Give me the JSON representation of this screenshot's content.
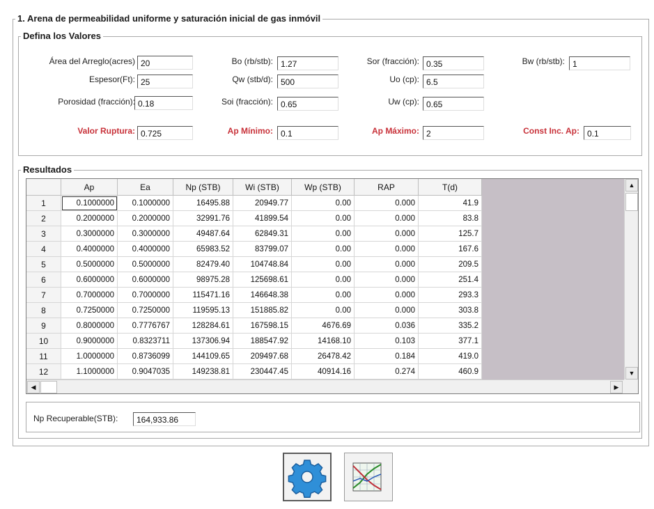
{
  "section_title": "1. Arena de permeabilidad uniforme y saturación inicial de gas inmóvil",
  "inputs": {
    "title": "Defina los Valores",
    "fields": [
      {
        "label": "Área del Arreglo(acres)",
        "value": "20"
      },
      {
        "label": "Bo (rb/stb):",
        "value": "1.27"
      },
      {
        "label": "Sor (fracción):",
        "value": "0.35"
      },
      {
        "label": "Bw (rb/stb):",
        "value": "1"
      },
      {
        "label": "Espesor(Ft):",
        "value": "25"
      },
      {
        "label": "Qw (stb/d):",
        "value": "500"
      },
      {
        "label": "Uo (cp):",
        "value": "6.5"
      },
      {
        "label": "Porosidad (fracción):",
        "value": "0.18"
      },
      {
        "label": "Soi (fracción):",
        "value": "0.65"
      },
      {
        "label": "Uw (cp):",
        "value": "0.65"
      },
      {
        "label": "Valor Ruptura:",
        "value": "0.725"
      },
      {
        "label": "Ap Mínimo:",
        "value": "0.1"
      },
      {
        "label": "Ap Máximo:",
        "value": "2"
      },
      {
        "label": "Const Inc. Ap:",
        "value": "0.1"
      }
    ],
    "highlight_color": "#c8323a"
  },
  "results": {
    "title": "Resultados",
    "columns": [
      "Ap",
      "Ea",
      "Np (STB)",
      "Wi (STB)",
      "Wp (STB)",
      "RAP",
      "T(d)"
    ],
    "rows": [
      [
        "1",
        "0.1000000",
        "0.1000000",
        "16495.88",
        "20949.77",
        "0.00",
        "0.000",
        "41.9"
      ],
      [
        "2",
        "0.2000000",
        "0.2000000",
        "32991.76",
        "41899.54",
        "0.00",
        "0.000",
        "83.8"
      ],
      [
        "3",
        "0.3000000",
        "0.3000000",
        "49487.64",
        "62849.31",
        "0.00",
        "0.000",
        "125.7"
      ],
      [
        "4",
        "0.4000000",
        "0.4000000",
        "65983.52",
        "83799.07",
        "0.00",
        "0.000",
        "167.6"
      ],
      [
        "5",
        "0.5000000",
        "0.5000000",
        "82479.40",
        "104748.84",
        "0.00",
        "0.000",
        "209.5"
      ],
      [
        "6",
        "0.6000000",
        "0.6000000",
        "98975.28",
        "125698.61",
        "0.00",
        "0.000",
        "251.4"
      ],
      [
        "7",
        "0.7000000",
        "0.7000000",
        "115471.16",
        "146648.38",
        "0.00",
        "0.000",
        "293.3"
      ],
      [
        "8",
        "0.7250000",
        "0.7250000",
        "119595.13",
        "151885.82",
        "0.00",
        "0.000",
        "303.8"
      ],
      [
        "9",
        "0.8000000",
        "0.7776767",
        "128284.61",
        "167598.15",
        "4676.69",
        "0.036",
        "335.2"
      ],
      [
        "10",
        "0.9000000",
        "0.8323711",
        "137306.94",
        "188547.92",
        "14168.10",
        "0.103",
        "377.1"
      ],
      [
        "11",
        "1.0000000",
        "0.8736099",
        "144109.65",
        "209497.68",
        "26478.42",
        "0.184",
        "419.0"
      ],
      [
        "12",
        "1.1000000",
        "0.9047035",
        "149238.81",
        "230447.45",
        "40914.16",
        "0.274",
        "460.9"
      ]
    ],
    "np_label": "Np Recuperable(STB):",
    "np_value": "164,933.86"
  },
  "toolbar": {
    "calculate_icon": "gear-icon",
    "chart_icon": "chart-icon"
  }
}
